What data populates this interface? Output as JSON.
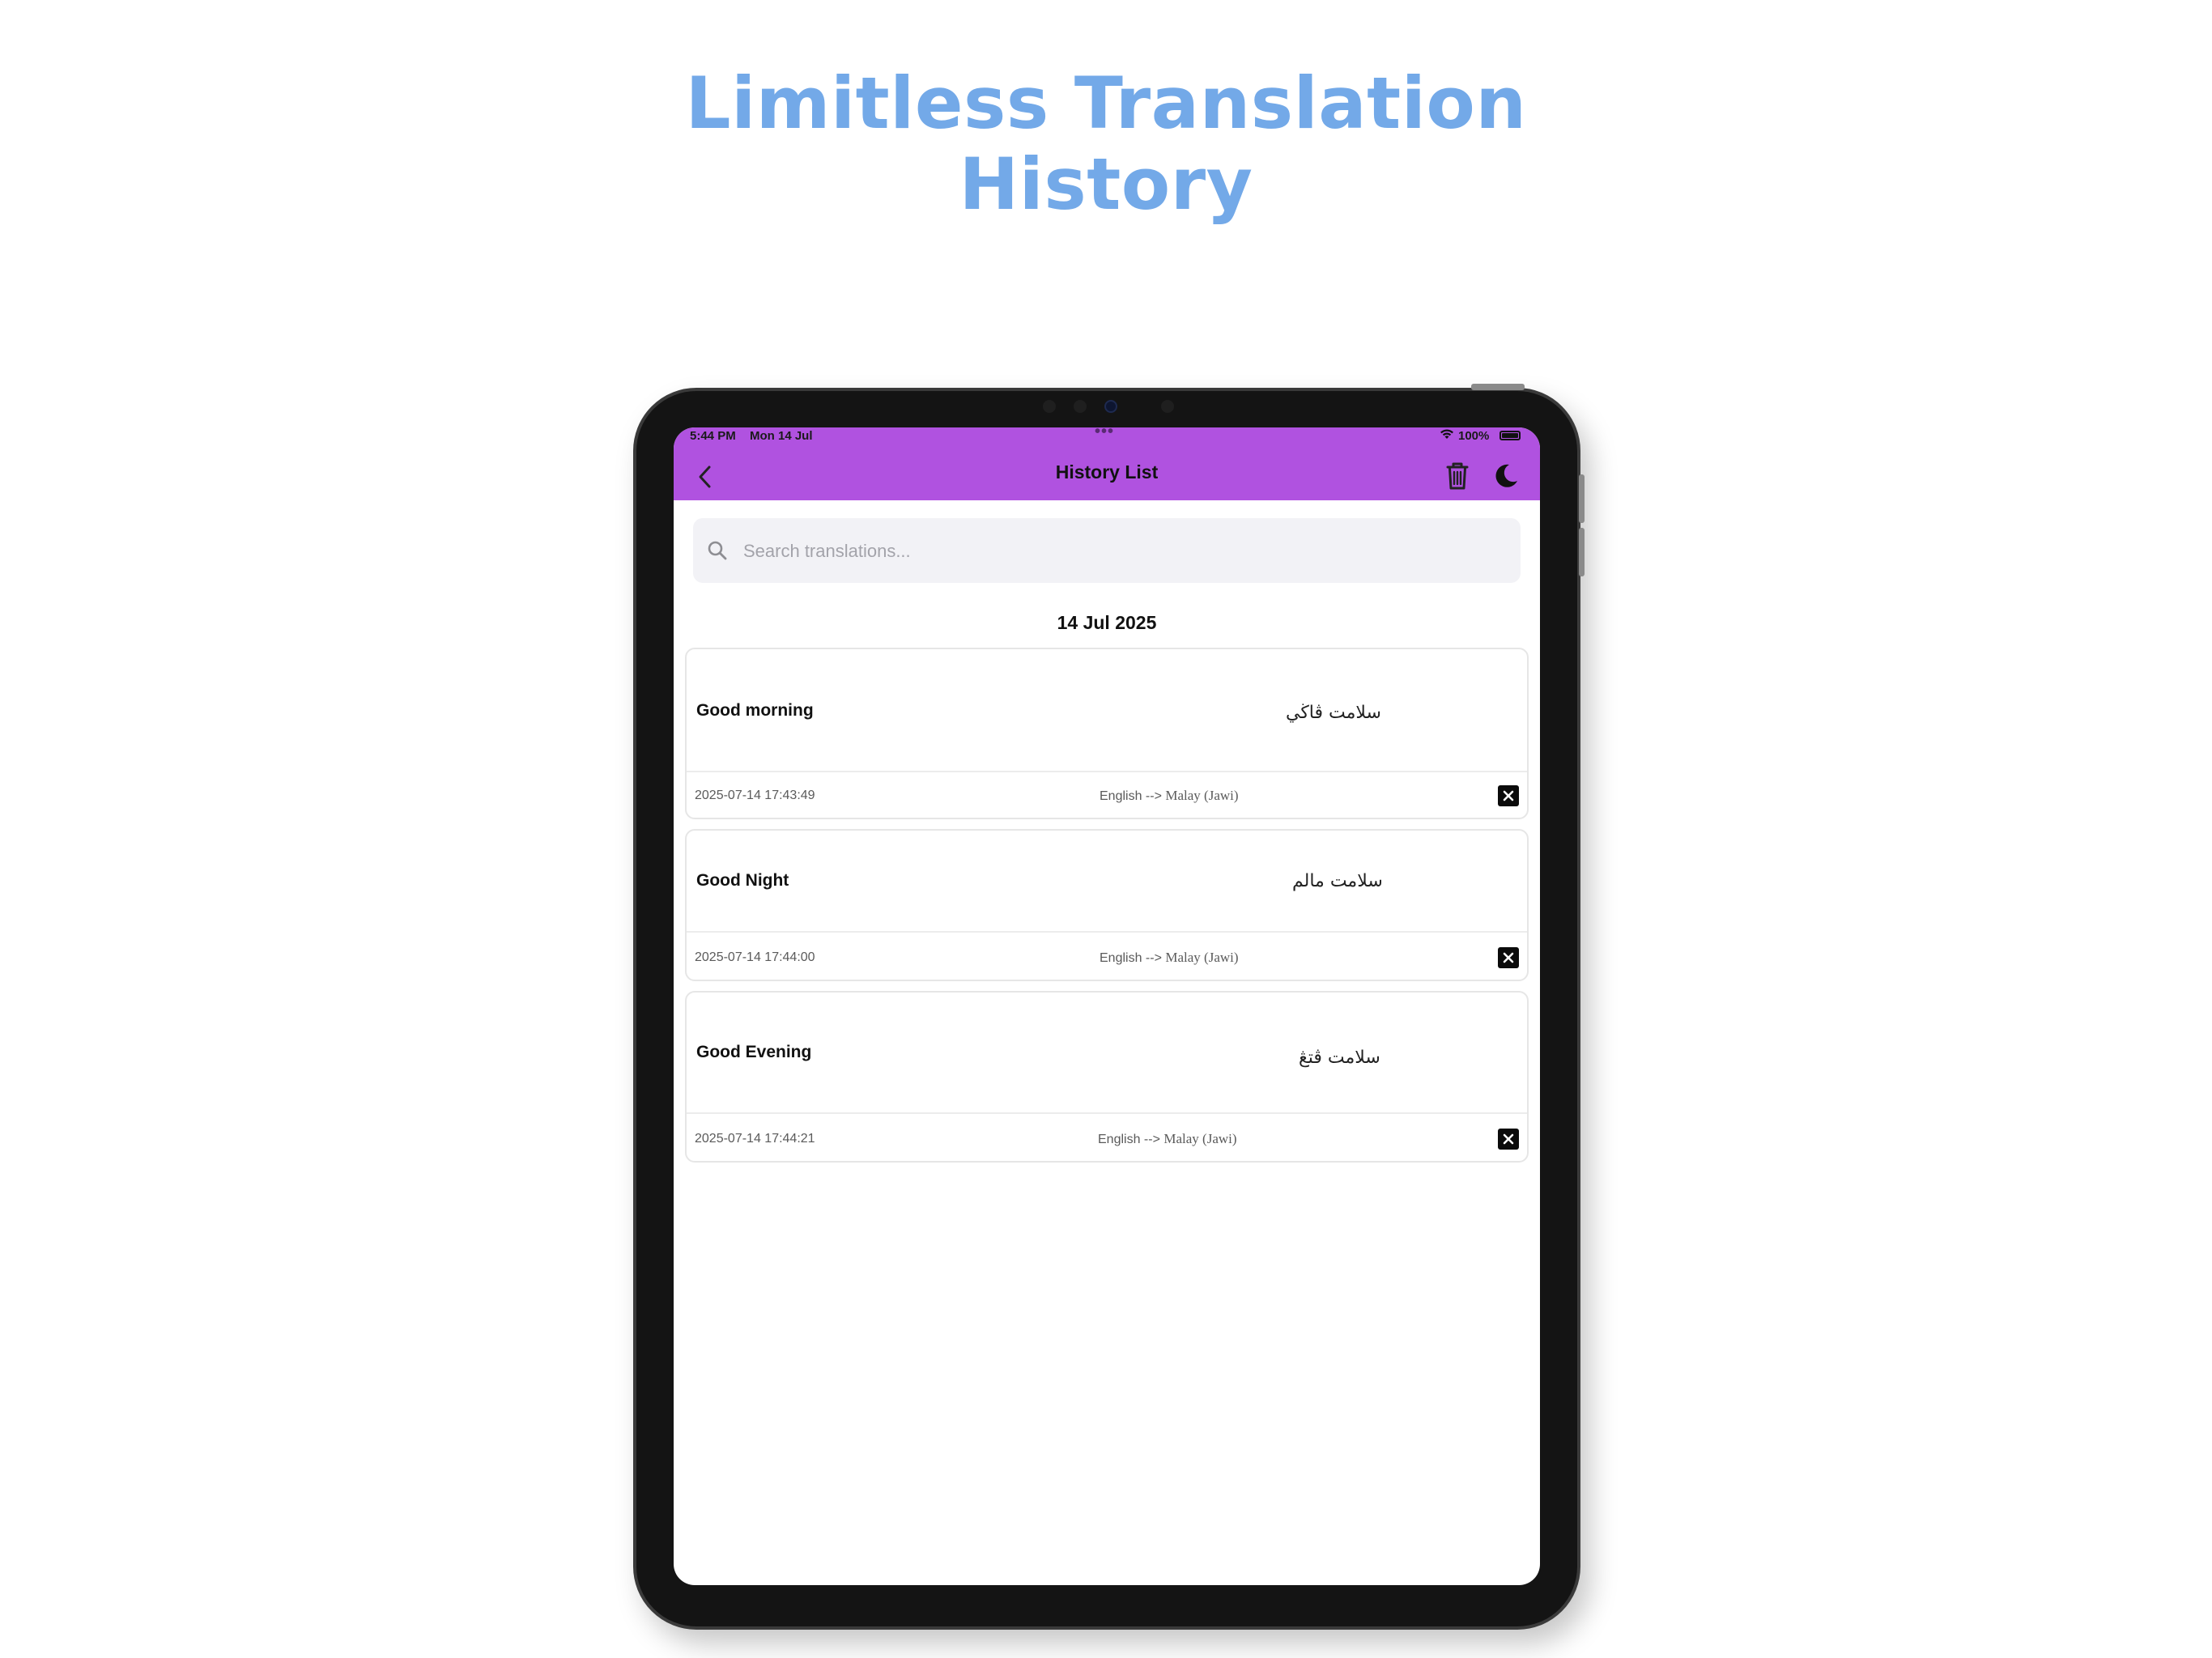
{
  "headline": {
    "line1": "Limitless Translation",
    "line2": "History"
  },
  "status_bar": {
    "time": "5:44 PM",
    "date": "Mon 14 Jul",
    "battery": "100%"
  },
  "header": {
    "title": "History List"
  },
  "search": {
    "placeholder": "Search translations..."
  },
  "section": {
    "date": "14 Jul 2025"
  },
  "items": [
    {
      "source": "Good morning",
      "translation": "سلامت ڤاڬي",
      "timestamp": "2025-07-14 17:43:49",
      "lang_from": "English -->",
      "lang_to": "Malay (Jawi)"
    },
    {
      "source": "Good Night",
      "translation": "سلامت مالم",
      "timestamp": "2025-07-14 17:44:00",
      "lang_from": "English -->",
      "lang_to": "Malay (Jawi)"
    },
    {
      "source": "Good Evening",
      "translation": "سلامت ڤتڠ",
      "timestamp": "2025-07-14 17:44:21",
      "lang_from": "English -->",
      "lang_to": "Malay (Jawi)"
    }
  ],
  "colors": {
    "accent": "#b052e0",
    "headline": "#73a9e8"
  }
}
